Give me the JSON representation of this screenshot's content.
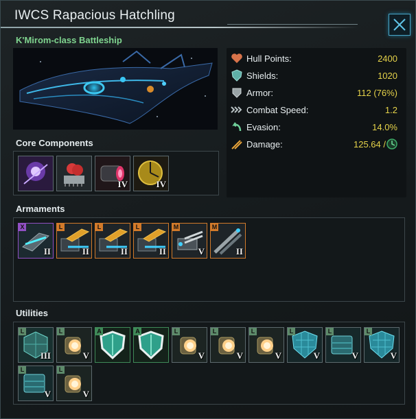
{
  "window": {
    "title": "IWCS Rapacious Hatchling",
    "subtitle": "K'Mirom-class Battleship"
  },
  "sections": {
    "core_components": "Core Components",
    "armaments": "Armaments",
    "utilities": "Utilities"
  },
  "stats": [
    {
      "label": "Hull Points:",
      "value": "2400",
      "icon": "hull-heart-icon"
    },
    {
      "label": "Shields:",
      "value": "1020",
      "icon": "shield-icon"
    },
    {
      "label": "Armor:",
      "value": "112 (76%)",
      "icon": "armor-icon"
    },
    {
      "label": "Combat Speed:",
      "value": "1.2",
      "icon": "speed-chevrons-icon"
    },
    {
      "label": "Evasion:",
      "value": "14.0%",
      "icon": "evasion-arrow-icon"
    },
    {
      "label": "Damage:",
      "value": "125.64 /",
      "icon": "damage-icon"
    }
  ],
  "core_components": [
    {
      "icon": "psionic-purple-orb-icon",
      "roman": ""
    },
    {
      "icon": "red-brain-computer-icon",
      "roman": ""
    },
    {
      "icon": "ftl-drive-icon",
      "roman": "IV"
    },
    {
      "icon": "sensor-radar-icon",
      "roman": "IV"
    }
  ],
  "armaments": [
    {
      "tier": "X",
      "roman": "II",
      "rarity": "purple",
      "icon": "x-slot-weapon-icon"
    },
    {
      "tier": "L",
      "roman": "II",
      "rarity": "orange",
      "icon": "large-cannon-icon"
    },
    {
      "tier": "L",
      "roman": "II",
      "rarity": "orange",
      "icon": "large-cannon-icon"
    },
    {
      "tier": "L",
      "roman": "II",
      "rarity": "orange",
      "icon": "large-cannon-icon"
    },
    {
      "tier": "M",
      "roman": "V",
      "rarity": "orange",
      "icon": "medium-turret-icon"
    },
    {
      "tier": "M",
      "roman": "II",
      "rarity": "orange",
      "icon": "medium-missile-icon"
    }
  ],
  "utilities": [
    {
      "tier": "L",
      "roman": "III",
      "rarity": "plain",
      "icon": "hex-armor-plate-icon"
    },
    {
      "tier": "L",
      "roman": "V",
      "rarity": "plain",
      "icon": "shield-generator-icon"
    },
    {
      "tier": "A",
      "roman": "",
      "rarity": "green",
      "icon": "aux-shield-icon"
    },
    {
      "tier": "A",
      "roman": "",
      "rarity": "green",
      "icon": "aux-shield-icon"
    },
    {
      "tier": "L",
      "roman": "V",
      "rarity": "plain",
      "icon": "shield-generator-icon"
    },
    {
      "tier": "L",
      "roman": "V",
      "rarity": "plain",
      "icon": "shield-generator-icon"
    },
    {
      "tier": "L",
      "roman": "V",
      "rarity": "plain",
      "icon": "shield-generator-icon"
    },
    {
      "tier": "L",
      "roman": "V",
      "rarity": "plain",
      "icon": "hex-armor-shield-icon"
    },
    {
      "tier": "L",
      "roman": "V",
      "rarity": "plain",
      "icon": "armor-plate-icon"
    },
    {
      "tier": "L",
      "roman": "V",
      "rarity": "plain",
      "icon": "hex-armor-shield-icon"
    },
    {
      "tier": "L",
      "roman": "V",
      "rarity": "plain",
      "icon": "armor-plate-icon"
    },
    {
      "tier": "L",
      "roman": "V",
      "rarity": "plain",
      "icon": "shield-generator-icon"
    }
  ],
  "colors": {
    "stat_value": "#e6d34a",
    "subtitle": "#7fd48f",
    "rarity_purple": "#9150c4",
    "rarity_orange": "#d27a2a",
    "rarity_green": "#3f8a58",
    "accent": "#4aa6c8"
  }
}
